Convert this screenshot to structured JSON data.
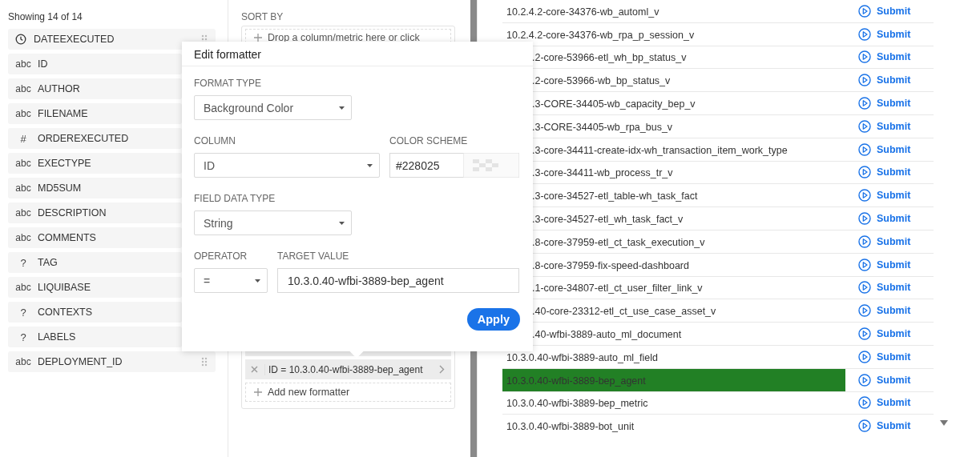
{
  "columns_panel": {
    "count_label": "Showing 14 of 14",
    "items": [
      {
        "kind": "time",
        "name": "DATEEXECUTED",
        "partial": false
      },
      {
        "kind": "text",
        "type_label": "abc",
        "name": "ID",
        "partial": true
      },
      {
        "kind": "text",
        "type_label": "abc",
        "name": "AUTHOR",
        "partial": true
      },
      {
        "kind": "text",
        "type_label": "abc",
        "name": "FILENAME",
        "partial": true
      },
      {
        "kind": "number",
        "type_label": "#",
        "name": "ORDEREXECUTED",
        "partial": true
      },
      {
        "kind": "text",
        "type_label": "abc",
        "name": "EXECTYPE",
        "partial": true
      },
      {
        "kind": "text",
        "type_label": "abc",
        "name": "MD5SUM",
        "partial": true
      },
      {
        "kind": "text",
        "type_label": "abc",
        "name": "DESCRIPTION",
        "partial": true
      },
      {
        "kind": "text",
        "type_label": "abc",
        "name": "COMMENTS",
        "partial": true
      },
      {
        "kind": "unknown",
        "type_label": "?",
        "name": "TAG",
        "partial": true
      },
      {
        "kind": "text",
        "type_label": "abc",
        "name": "LIQUIBASE",
        "partial": true
      },
      {
        "kind": "unknown",
        "type_label": "?",
        "name": "CONTEXTS",
        "partial": true
      },
      {
        "kind": "unknown",
        "type_label": "?",
        "name": "LABELS",
        "partial": true
      },
      {
        "kind": "text",
        "type_label": "abc",
        "name": "DEPLOYMENT_ID",
        "partial": false
      }
    ]
  },
  "query_panel": {
    "sort_by_label": "SORT BY",
    "drop_hint": "Drop a column/metric here or click",
    "formatters": [
      {
        "label": "ID = 10.3.0.40-wfbi-3889-bep_agent"
      }
    ],
    "add_formatter": "Add new formatter"
  },
  "edit_formatter": {
    "title": "Edit formatter",
    "format_type_label": "FORMAT TYPE",
    "format_type": "Background Color",
    "column_label": "COLUMN",
    "column": "ID",
    "color_scheme_label": "COLOR SCHEME",
    "color_value": "#228025",
    "field_data_type_label": "FIELD DATA TYPE",
    "field_data_type": "String",
    "operator_label": "OPERATOR",
    "operator": "=",
    "target_value_label": "TARGET VALUE",
    "target_value": "10.3.0.40-wfbi-3889-bep_agent",
    "apply_button": "Apply"
  },
  "table": {
    "rows": [
      {
        "id": "10.2.4.2-core-34376-wb_automl_v",
        "partial": false,
        "action": "Submit"
      },
      {
        "id": "10.2.4.2-core-34376-wb_rpa_p_session_v",
        "partial": false,
        "action": "Submit"
      },
      {
        "id": ".2-core-53966-etl_wh_bp_status_v",
        "partial": true,
        "action": "Submit"
      },
      {
        "id": ".2-core-53966-wb_bp_status_v",
        "partial": true,
        "action": "Submit"
      },
      {
        "id": ".3-CORE-34405-wb_capacity_bep_v",
        "partial": true,
        "action": "Submit"
      },
      {
        "id": ".3-CORE-34405-wb_rpa_bus_v",
        "partial": true,
        "action": "Submit"
      },
      {
        "id": ".3-core-34411-create-idx-wh_transaction_item_work_type",
        "partial": true,
        "action": "Submit"
      },
      {
        "id": ".3-core-34411-wb_process_tr_v",
        "partial": true,
        "action": "Submit"
      },
      {
        "id": ".3-core-34527-etl_table-wh_task_fact",
        "partial": true,
        "action": "Submit"
      },
      {
        "id": ".3-core-34527-etl_wh_task_fact_v",
        "partial": true,
        "action": "Submit"
      },
      {
        "id": ".8-core-37959-etl_ct_task_execution_v",
        "partial": true,
        "action": "Submit"
      },
      {
        "id": ".8-core-37959-fix-speed-dashboard",
        "partial": true,
        "action": "Submit"
      },
      {
        "id": ".1-core-34807-etl_ct_user_filter_link_v",
        "partial": true,
        "action": "Submit"
      },
      {
        "id": ".40-core-23312-etl_ct_use_case_asset_v",
        "partial": true,
        "action": "Submit"
      },
      {
        "id": ".40-wfbi-3889-auto_ml_document",
        "partial": true,
        "action": "Submit"
      },
      {
        "id": "10.3.0.40-wfbi-3889-auto_ml_field",
        "partial": false,
        "action": "Submit"
      },
      {
        "id": "10.3.0.40-wfbi-3889-bep_agent",
        "partial": false,
        "color": "#228025",
        "action": "Submit"
      },
      {
        "id": "10.3.0.40-wfbi-3889-bep_metric",
        "partial": false,
        "action": "Submit"
      },
      {
        "id": "10.3.0.40-wfbi-3889-bot_unit",
        "partial": false,
        "action": "Submit"
      }
    ]
  }
}
